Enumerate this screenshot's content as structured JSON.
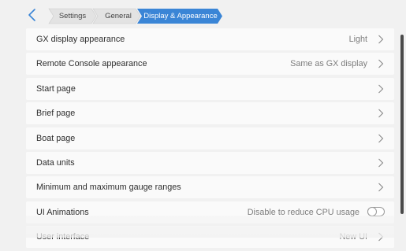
{
  "breadcrumb": {
    "items": [
      "Settings",
      "General",
      "Display & Appearance"
    ]
  },
  "colors": {
    "accent": "#3a85d6",
    "crumb_bg": "#e3e3e3",
    "row_bg": "#fafafa",
    "page_bg": "#f1f1f1"
  },
  "rows": [
    {
      "label": "GX display appearance",
      "value": "Light",
      "control": "chevron-right-icon"
    },
    {
      "label": "Remote Console appearance",
      "value": "Same as GX display",
      "control": "chevron-right-icon"
    },
    {
      "label": "Start page",
      "value": "",
      "control": "chevron-right-icon"
    },
    {
      "label": "Brief page",
      "value": "",
      "control": "chevron-right-icon"
    },
    {
      "label": "Boat page",
      "value": "",
      "control": "chevron-right-icon"
    },
    {
      "label": "Data units",
      "value": "",
      "control": "chevron-right-icon"
    },
    {
      "label": "Minimum and maximum gauge ranges",
      "value": "",
      "control": "chevron-right-icon"
    },
    {
      "label": "UI Animations",
      "value": "Disable to reduce CPU usage",
      "control": "toggle",
      "toggle_on": false
    },
    {
      "label": "User interface",
      "value": "New UI",
      "control": "chevron-right-icon"
    }
  ]
}
